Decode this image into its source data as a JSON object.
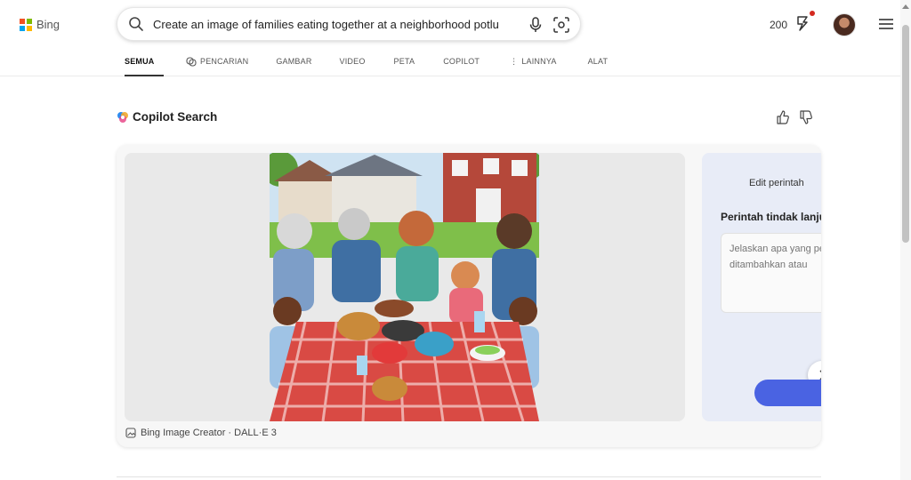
{
  "brand": {
    "name": "Bing",
    "logo_colors": [
      "#f25022",
      "#7fba00",
      "#00a4ef",
      "#ffb900"
    ]
  },
  "search": {
    "value": "Create an image of families eating together at a neighborhood potlu",
    "icons": [
      "search-icon",
      "mic-icon",
      "camera-icon"
    ]
  },
  "header": {
    "points": "200",
    "icons": [
      "rewards-icon",
      "avatar",
      "hamburger-menu-icon"
    ]
  },
  "tabs": [
    {
      "label": "SEMUA",
      "active": true
    },
    {
      "label": "PENCARIAN",
      "icon": "copilot-chat-icon"
    },
    {
      "label": "GAMBAR"
    },
    {
      "label": "VIDEO"
    },
    {
      "label": "PETA"
    },
    {
      "label": "COPILOT"
    },
    {
      "label": "LAINNYA",
      "icon": "more-dots-icon"
    },
    {
      "label": "ALAT"
    }
  ],
  "copilot": {
    "title": "Copilot Search"
  },
  "result_card": {
    "image_alt": "Illustration of a family eating together at a picnic table with burgers, salads and drinks in front of neighborhood houses",
    "credit": "Bing Image Creator · DALL·E 3",
    "side_panel": {
      "edit_label": "Edit perintah",
      "followup_title": "Perintah tindak lanjut",
      "followup_placeholder": "Jelaskan apa yang perlu ditambahkan atau diganti..."
    }
  },
  "colors": {
    "accent": "#4a63e2",
    "notification": "#d42a20",
    "side_panel_bg": "#e8ecf7"
  }
}
